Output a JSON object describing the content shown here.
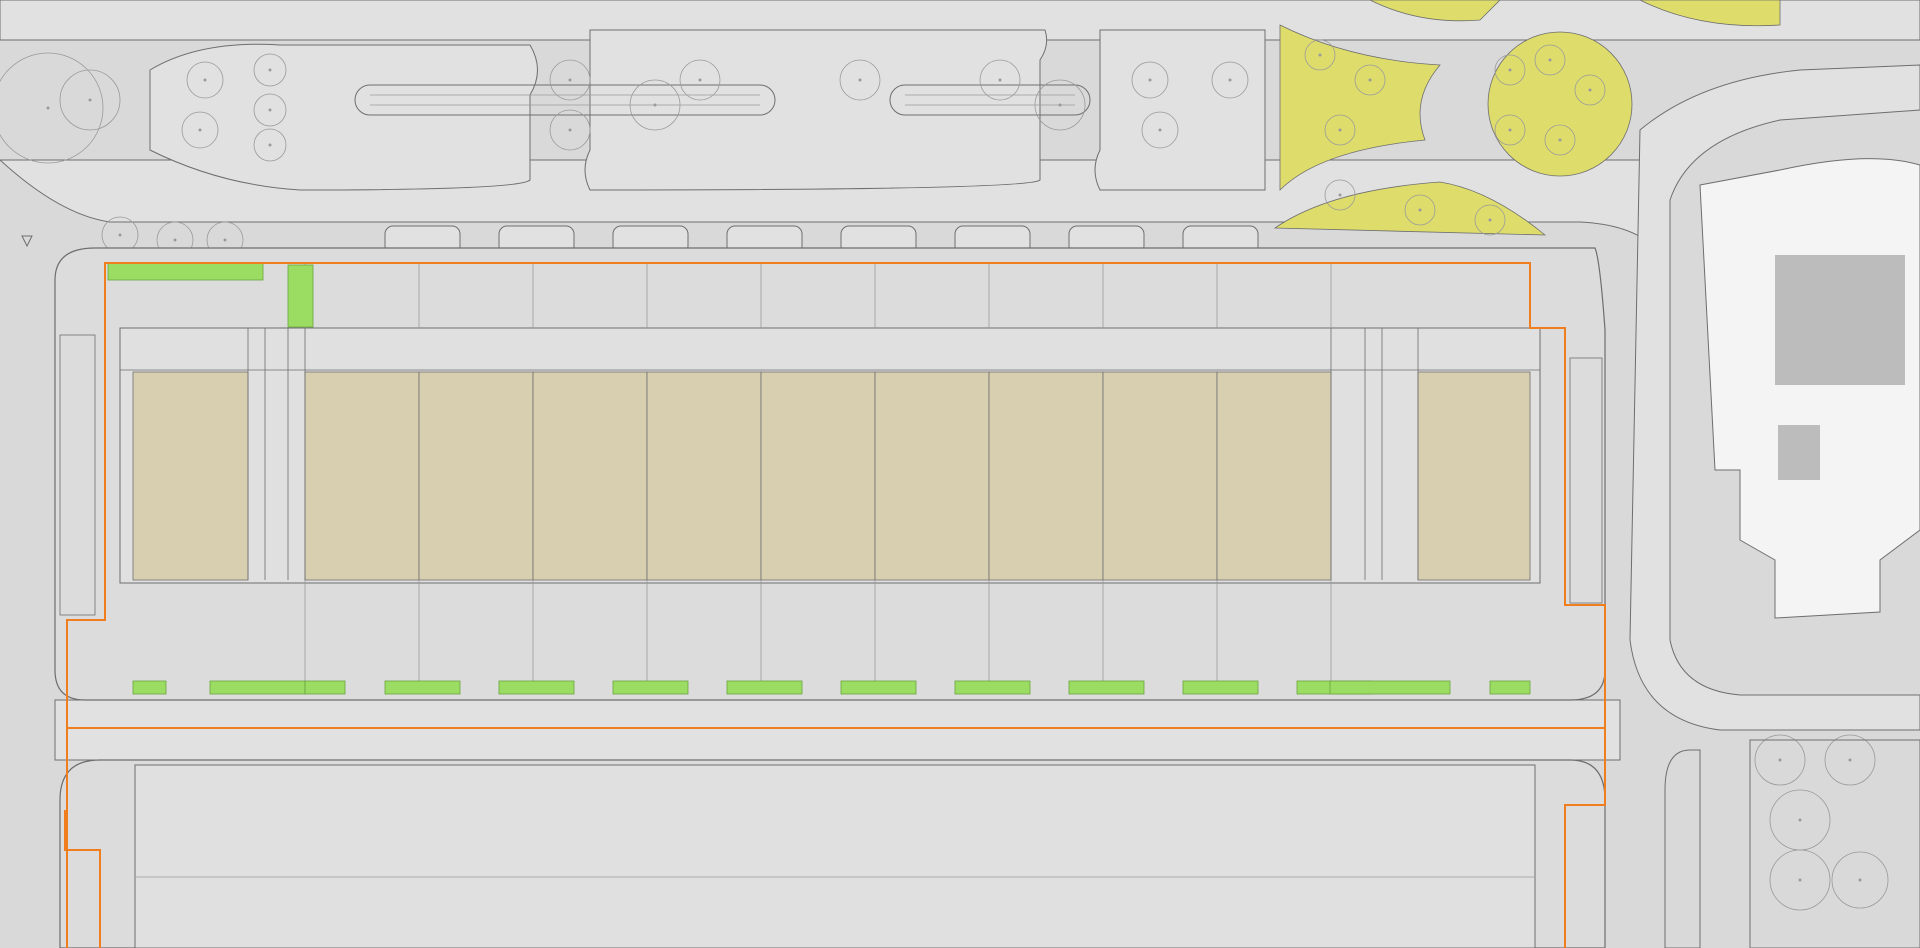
{
  "colors": {
    "background": "#d9d9d9",
    "street": "#e1e1e1",
    "linework": "#6e6e6e",
    "fine_line": "#9a9a9a",
    "site_boundary": "#f07d1e",
    "building_footprint": "#d8cfb0",
    "planting_green": "#9bdc63",
    "landscape_yellow": "#dedd6c",
    "existing_building": "#f4f4f4",
    "existing_building_core": "#bcbcbc",
    "bench_dark": "#3c3c3c"
  },
  "icons": [
    "tree-circle-icon",
    "triangle-marker-icon",
    "feature-tree-icon"
  ],
  "legend": null
}
